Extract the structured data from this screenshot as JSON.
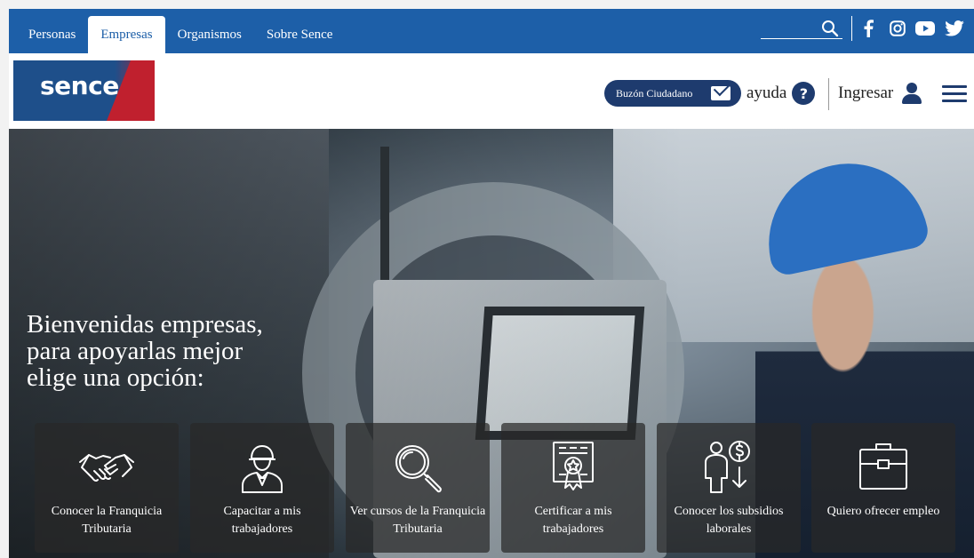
{
  "topnav": {
    "tabs": [
      {
        "label": "Personas",
        "active": false
      },
      {
        "label": "Empresas",
        "active": true
      },
      {
        "label": "Organismos",
        "active": false
      },
      {
        "label": "Sobre Sence",
        "active": false
      }
    ],
    "icons": [
      "search-icon",
      "facebook-icon",
      "instagram-icon",
      "youtube-icon",
      "twitter-icon"
    ]
  },
  "header": {
    "logo_text": "sence",
    "buzon_label": "Buzón Ciudadano",
    "ayuda_label": "ayuda",
    "ingresar_label": "Ingresar"
  },
  "hero": {
    "welcome_lines": [
      "Bienvenidas empresas,",
      "para apoyarlas mejor",
      "elige una opción:"
    ]
  },
  "cards": [
    {
      "icon": "handshake-icon",
      "label": "Conocer la Franquicia Tributaria"
    },
    {
      "icon": "worker-icon",
      "label": "Capacitar a mis trabajadores"
    },
    {
      "icon": "magnifier-icon",
      "label": "Ver cursos de la Franquicia Tributaria"
    },
    {
      "icon": "certificate-icon",
      "label": "Certificar a mis trabajadores"
    },
    {
      "icon": "subsidy-icon",
      "label": "Conocer los subsidios laborales"
    },
    {
      "icon": "briefcase-icon",
      "label": "Quiero ofrecer empleo"
    }
  ],
  "colors": {
    "topbar": "#1d5fa8",
    "navy": "#1e3b6e",
    "logo_red": "#c0202e"
  }
}
